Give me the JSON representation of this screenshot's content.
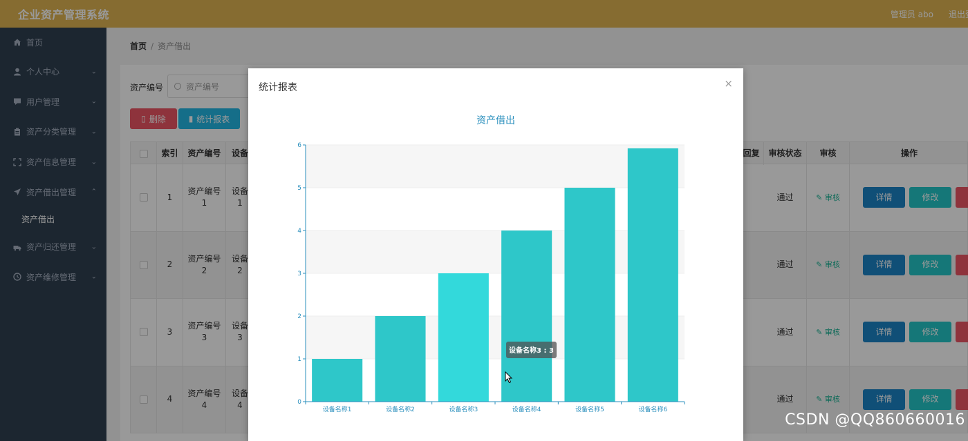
{
  "header": {
    "app_title": "企业资产管理系统",
    "user_label": "管理员 abo",
    "logout_label": "退出登录"
  },
  "sidebar": {
    "items": [
      {
        "label": "首页",
        "icon": "home-icon",
        "has_children": false
      },
      {
        "label": "个人中心",
        "icon": "user-icon",
        "has_children": true
      },
      {
        "label": "用户管理",
        "icon": "chat-icon",
        "has_children": true
      },
      {
        "label": "资产分类管理",
        "icon": "clipboard-icon",
        "has_children": true
      },
      {
        "label": "资产信息管理",
        "icon": "expand-icon",
        "has_children": true
      },
      {
        "label": "资产借出管理",
        "icon": "send-icon",
        "has_children": true,
        "expanded": true
      },
      {
        "label": "资产归还管理",
        "icon": "truck-icon",
        "has_children": true
      },
      {
        "label": "资产维修管理",
        "icon": "clock-icon",
        "has_children": true
      }
    ],
    "sub_item": "资产借出"
  },
  "breadcrumb": {
    "home": "首页",
    "sep": "/",
    "current": "资产借出"
  },
  "search": {
    "label": "资产编号",
    "placeholder": "资产编号"
  },
  "toolbar": {
    "delete_label": "删除",
    "stats_label": "统计报表"
  },
  "table": {
    "headers": {
      "index": "索引",
      "asset_no": "资产编号",
      "device": "设备",
      "reply": "回复",
      "audit_status": "审核状态",
      "audit": "审核",
      "actions": "操作"
    },
    "rows": [
      {
        "index": "1",
        "asset_no_1": "资产编号",
        "asset_no_2": "1",
        "device_1": "设备",
        "device_2": "1",
        "status": "通过",
        "audit": "审核"
      },
      {
        "index": "2",
        "asset_no_1": "资产编号",
        "asset_no_2": "2",
        "device_1": "设备",
        "device_2": "2",
        "status": "通过",
        "audit": "审核"
      },
      {
        "index": "3",
        "asset_no_1": "资产编号",
        "asset_no_2": "3",
        "device_1": "设备",
        "device_2": "3",
        "status": "通过",
        "audit": "审核"
      },
      {
        "index": "4",
        "asset_no_1": "资产编号",
        "asset_no_2": "4",
        "device_1": "设备",
        "device_2": "4",
        "status": "通过",
        "audit": "审核"
      }
    ],
    "detail_label": "详情",
    "edit_label": "修改"
  },
  "modal": {
    "title": "统计报表",
    "close": "×"
  },
  "chart_data": {
    "type": "bar",
    "title": "资产借出",
    "categories": [
      "设备名称1",
      "设备名称2",
      "设备名称3",
      "设备名称4",
      "设备名称5",
      "设备名称6"
    ],
    "values": [
      1,
      2,
      3,
      4,
      5,
      5.92
    ],
    "ylim": [
      0,
      6
    ],
    "yticks": [
      0,
      1,
      2,
      3,
      4,
      5,
      6
    ],
    "grid": true,
    "bar_color": "#2ec7c9",
    "highlight_color": "#33d9db",
    "highlight_index": 2,
    "tooltip": "设备名称3 : 3"
  },
  "watermark": "CSDN @QQ860660016"
}
